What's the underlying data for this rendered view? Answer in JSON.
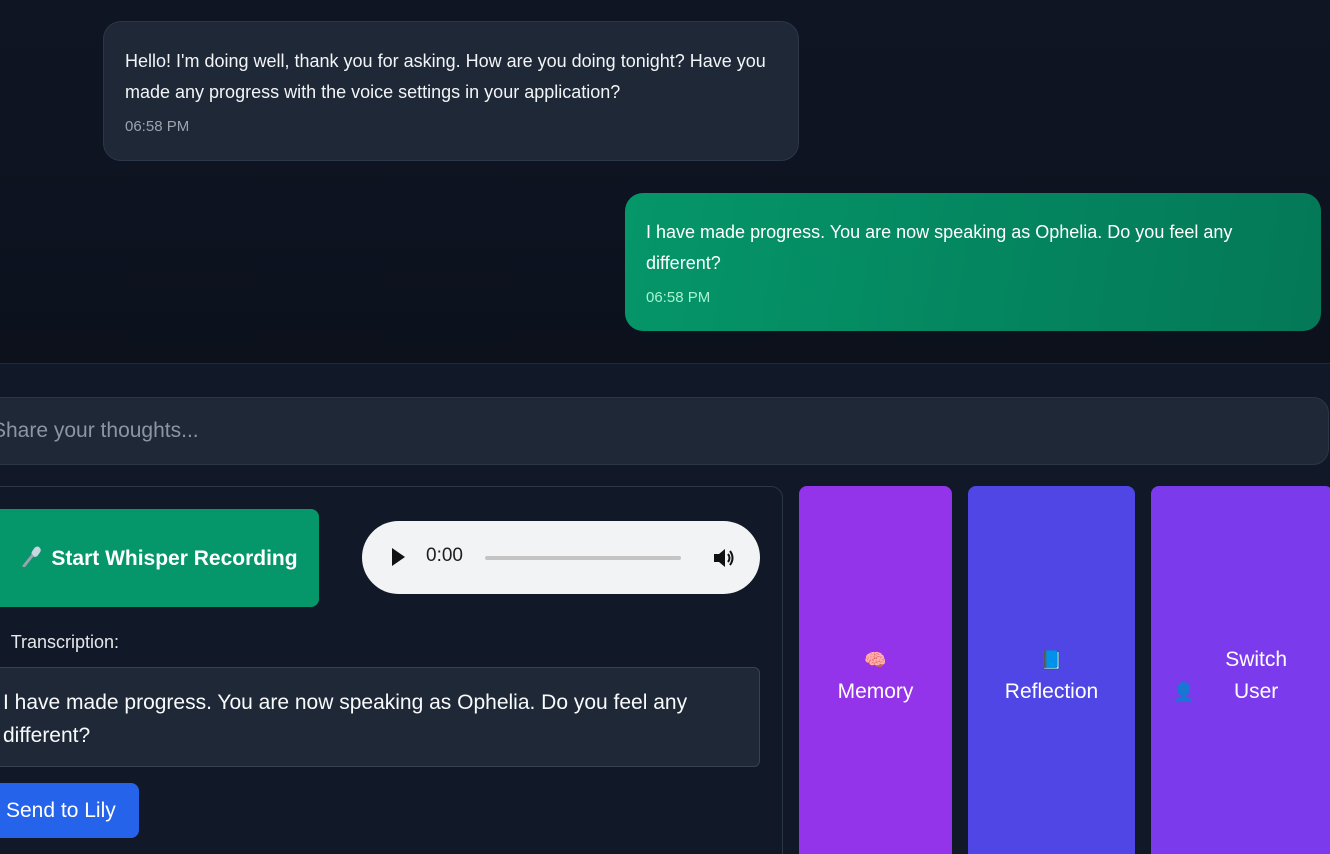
{
  "messages": [
    {
      "role": "assistant",
      "text": "Hello! I'm doing well, thank you for asking. How are you doing tonight? Have you made any progress with the voice settings in your application?",
      "time": "06:58 PM"
    },
    {
      "role": "user",
      "text": "I have made progress. You are now speaking as Ophelia. Do you feel any different?",
      "time": "06:58 PM"
    }
  ],
  "input": {
    "placeholder": "Share your thoughts..."
  },
  "voice": {
    "record_button_label": "Start Whisper Recording",
    "record_icon": "microphone-icon",
    "audio_time": "0:00",
    "transcription_label": "Transcription:",
    "transcription_text": "I have made progress. You are now speaking as Ophelia. Do you feel any different?",
    "send_button_label": "Send to Lily"
  },
  "side_buttons": {
    "memory": {
      "icon": "🧠",
      "label": "Memory"
    },
    "reflection": {
      "icon": "📘",
      "label": "Reflection"
    },
    "switch_user": {
      "icon": "👤",
      "label": "Switch User"
    }
  },
  "colors": {
    "user_bubble": "#059669",
    "record_button": "#059669",
    "send_button": "#2563eb",
    "memory_button": "#9333ea",
    "reflection_button": "#4f46e5",
    "switch_user_button": "#7c3aed"
  }
}
